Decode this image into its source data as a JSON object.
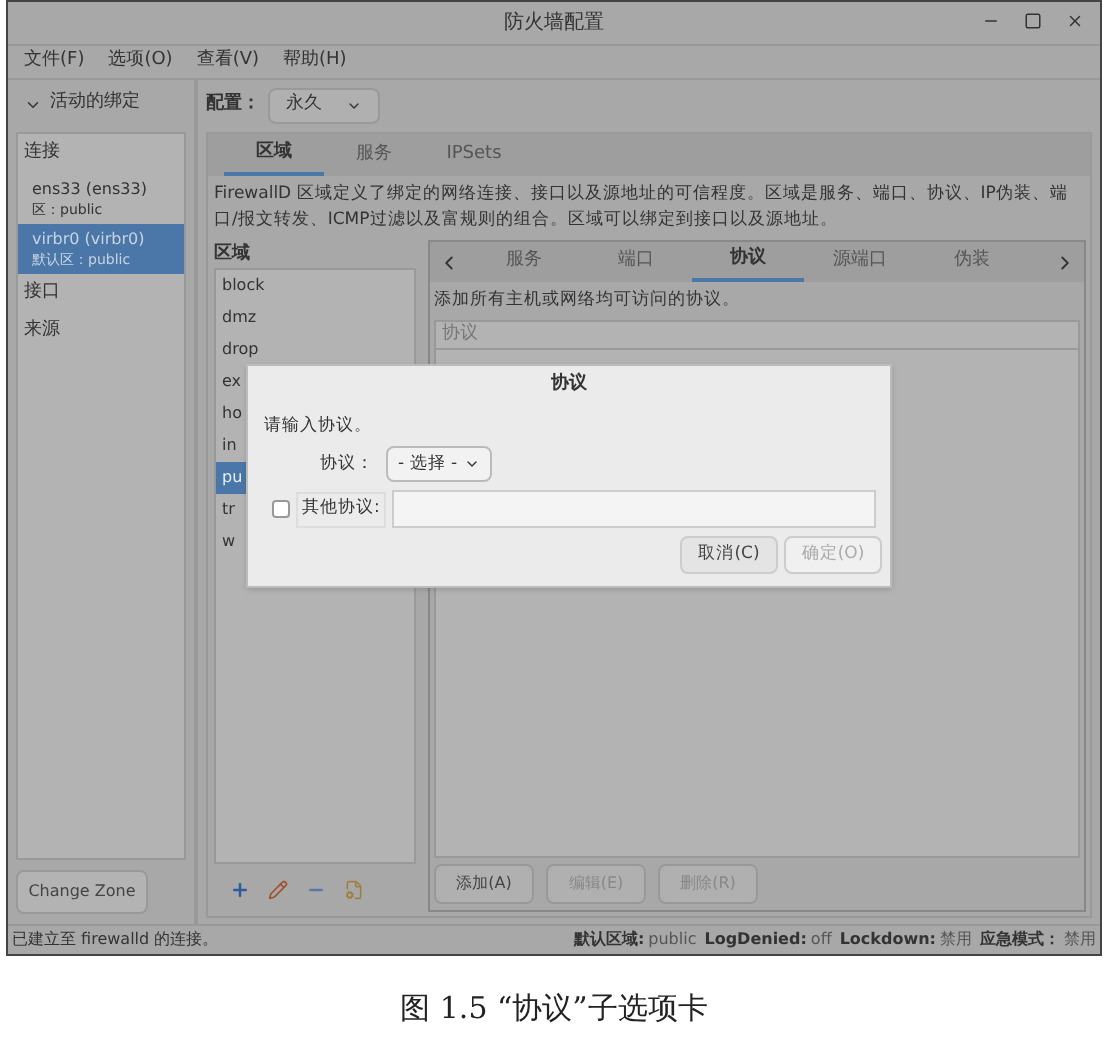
{
  "window": {
    "title": "防火墙配置"
  },
  "menu": [
    {
      "label": "文件(F)"
    },
    {
      "label": "选项(O)"
    },
    {
      "label": "查看(V)"
    },
    {
      "label": "帮助(H)"
    }
  ],
  "sidebar": {
    "header": "活动的绑定",
    "expanded": true,
    "items": [
      {
        "kind": "heading",
        "label": "连接"
      },
      {
        "kind": "item",
        "label": "ens33 (ens33)",
        "sub": "区：public",
        "selected": false
      },
      {
        "kind": "item",
        "label": "virbr0 (virbr0)",
        "sub": "默认区：public",
        "selected": true
      },
      {
        "kind": "heading",
        "label": "接口"
      },
      {
        "kind": "heading",
        "label": "来源"
      }
    ],
    "button": "Change Zone"
  },
  "config": {
    "label": "配置：",
    "value": "永久"
  },
  "tabs": [
    {
      "label": "区域",
      "selected": true
    },
    {
      "label": "服务",
      "selected": false
    },
    {
      "label": "IPSets",
      "selected": false
    }
  ],
  "description": "FirewallD 区域定义了绑定的网络连接、接口以及源地址的可信程度。区域是服务、端口、协议、IP伪装、端口/报文转发、ICMP过滤以及富规则的组合。区域可以绑定到接口以及源地址。",
  "zones": {
    "heading": "区域",
    "items": [
      {
        "label": "block",
        "selected": false
      },
      {
        "label": "dmz",
        "selected": false
      },
      {
        "label": "drop",
        "selected": false
      },
      {
        "label": "ex",
        "selected": false
      },
      {
        "label": "ho",
        "selected": false
      },
      {
        "label": "in",
        "selected": false
      },
      {
        "label": "pu",
        "selected": true
      },
      {
        "label": "tr",
        "selected": false
      },
      {
        "label": "w",
        "selected": false
      }
    ]
  },
  "subtabs": [
    {
      "label": "服务",
      "selected": false
    },
    {
      "label": "端口",
      "selected": false
    },
    {
      "label": "协议",
      "selected": true
    },
    {
      "label": "源端口",
      "selected": false
    },
    {
      "label": "伪装",
      "selected": false
    }
  ],
  "protocols": {
    "hint": "添加所有主机或网络均可访问的协议。",
    "column": "协议",
    "buttons": [
      {
        "label": "添加(A)",
        "disabled": false
      },
      {
        "label": "编辑(E)",
        "disabled": true
      },
      {
        "label": "删除(R)",
        "disabled": true
      }
    ]
  },
  "dialog": {
    "title": "协议",
    "prompt": "请输入协议。",
    "protocol_label": "协议：",
    "protocol_value": "- 选择 -",
    "other_label": "其他协议:",
    "other_checked": false,
    "buttons": [
      {
        "label": "取消(C)",
        "disabled": false
      },
      {
        "label": "确定(O)",
        "disabled": true
      }
    ]
  },
  "status_bar": {
    "left": "已建立至 firewalld 的连接。",
    "items": [
      {
        "key": "默认区域:",
        "value": "public"
      },
      {
        "key": "LogDenied:",
        "value": "off"
      },
      {
        "key": "Lockdown:",
        "value": "禁用"
      },
      {
        "key": "应急模式：",
        "value": "禁用"
      }
    ]
  },
  "caption": "图 1.5 “协议”子选项卡"
}
